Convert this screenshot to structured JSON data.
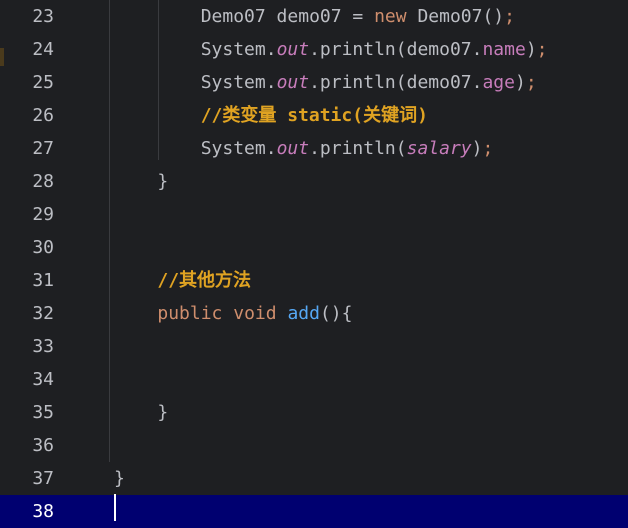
{
  "lines": [
    {
      "num": "23",
      "indent": "        ",
      "tokens": [
        {
          "t": "Demo07 demo07 = ",
          "c": "plain"
        },
        {
          "t": "new",
          "c": "kw"
        },
        {
          "t": " Demo07()",
          "c": "plain"
        },
        {
          "t": ";",
          "c": "semi"
        }
      ]
    },
    {
      "num": "24",
      "indent": "        ",
      "tokens": [
        {
          "t": "System.",
          "c": "plain"
        },
        {
          "t": "out",
          "c": "static"
        },
        {
          "t": ".println(demo07.",
          "c": "plain"
        },
        {
          "t": "name",
          "c": "field"
        },
        {
          "t": ")",
          "c": "plain"
        },
        {
          "t": ";",
          "c": "semi"
        }
      ]
    },
    {
      "num": "25",
      "indent": "        ",
      "tokens": [
        {
          "t": "System.",
          "c": "plain"
        },
        {
          "t": "out",
          "c": "static"
        },
        {
          "t": ".println(demo07.",
          "c": "plain"
        },
        {
          "t": "age",
          "c": "field"
        },
        {
          "t": ")",
          "c": "plain"
        },
        {
          "t": ";",
          "c": "semi"
        }
      ]
    },
    {
      "num": "26",
      "indent": "        ",
      "tokens": [
        {
          "t": "//类变量 static(关键词)",
          "c": "cmt"
        }
      ]
    },
    {
      "num": "27",
      "indent": "        ",
      "tokens": [
        {
          "t": "System.",
          "c": "plain"
        },
        {
          "t": "out",
          "c": "static"
        },
        {
          "t": ".println(",
          "c": "plain"
        },
        {
          "t": "salary",
          "c": "static"
        },
        {
          "t": ")",
          "c": "plain"
        },
        {
          "t": ";",
          "c": "semi"
        }
      ]
    },
    {
      "num": "28",
      "indent": "    ",
      "tokens": [
        {
          "t": "}",
          "c": "plain"
        }
      ]
    },
    {
      "num": "29",
      "indent": "",
      "tokens": []
    },
    {
      "num": "30",
      "indent": "",
      "tokens": []
    },
    {
      "num": "31",
      "indent": "    ",
      "tokens": [
        {
          "t": "//其他方法",
          "c": "cmt"
        }
      ]
    },
    {
      "num": "32",
      "indent": "    ",
      "tokens": [
        {
          "t": "public",
          "c": "kw"
        },
        {
          "t": " ",
          "c": "plain"
        },
        {
          "t": "void",
          "c": "kw"
        },
        {
          "t": " ",
          "c": "plain"
        },
        {
          "t": "add",
          "c": "fn"
        },
        {
          "t": "(){",
          "c": "plain"
        }
      ]
    },
    {
      "num": "33",
      "indent": "",
      "tokens": []
    },
    {
      "num": "34",
      "indent": "",
      "tokens": []
    },
    {
      "num": "35",
      "indent": "    ",
      "tokens": [
        {
          "t": "}",
          "c": "plain"
        }
      ]
    },
    {
      "num": "36",
      "indent": "",
      "tokens": []
    },
    {
      "num": "37",
      "indent": "",
      "tokens": [
        {
          "t": "}",
          "c": "plain"
        }
      ]
    },
    {
      "num": "38",
      "indent": "",
      "tokens": [],
      "current": true
    }
  ],
  "colors": {
    "background": "#1e1f22",
    "current_line": "#000070",
    "keyword": "#cf8e6d",
    "field": "#c77dbb",
    "method": "#56a8f5",
    "comment": "#e0a322",
    "plain": "#bcbec4"
  }
}
